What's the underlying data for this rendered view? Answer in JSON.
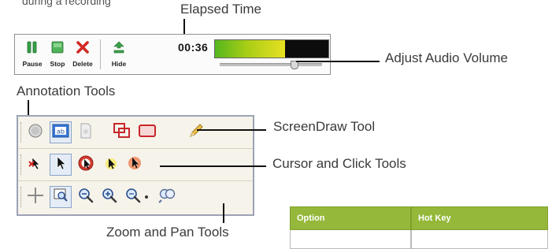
{
  "top_text": "during a recording",
  "callouts": {
    "elapsed_time": "Elapsed Time",
    "adjust_audio_volume": "Adjust Audio Volume",
    "annotation_tools": "Annotation Tools",
    "screendraw_tool": "ScreenDraw Tool",
    "cursor_click_tools": "Cursor and Click Tools",
    "zoom_pan_tools": "Zoom and Pan Tools"
  },
  "recorder": {
    "buttons": [
      {
        "label": "Pause",
        "icon": "pause-icon"
      },
      {
        "label": "Stop",
        "icon": "stop-icon"
      },
      {
        "label": "Delete",
        "icon": "delete-icon"
      },
      {
        "label": "Hide",
        "icon": "hide-icon"
      }
    ],
    "elapsed_time": "00:36",
    "audio_level": 0.62,
    "volume_level": 0.73,
    "colors": {
      "meter_green": "#55b61e",
      "meter_yellow": "#e7e022"
    }
  },
  "tools_panel": {
    "rows": [
      {
        "name": "annotation-row",
        "icons": [
          "clock-icon",
          "text-box-icon",
          "document-icon",
          "highlight-frame-icon",
          "rectangle-callout-icon",
          "pencil-icon"
        ]
      },
      {
        "name": "cursor-row",
        "icons": [
          "hide-cursor-icon",
          "cursor-icon",
          "click-cursor-icon",
          "highlight-cursor-icon",
          "click-highlight-cursor-icon"
        ]
      },
      {
        "name": "zoom-pan-row",
        "icons": [
          "pan-icon",
          "zoom-full-icon",
          "zoom-out-icon",
          "zoom-in-icon",
          "zoom-icon",
          "dropdown-arrow-icon",
          "zoom-custom-icon"
        ]
      }
    ]
  },
  "table": {
    "headers": [
      "Option",
      "Hot Key"
    ],
    "header_color": "#95b83a"
  }
}
